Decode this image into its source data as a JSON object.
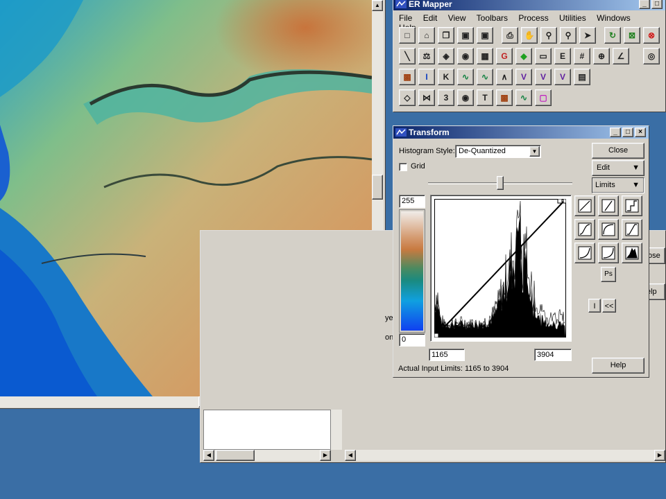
{
  "map_window": {
    "scroll_up_glyph": "▲",
    "scroll_down_glyph": "▼",
    "scroll_left_glyph": "◀",
    "scroll_right_glyph": "▶"
  },
  "er_mapper": {
    "title": "ER Mapper",
    "menus": [
      "File",
      "Edit",
      "View",
      "Toolbars",
      "Process",
      "Utilities",
      "Windows",
      "Help"
    ],
    "toolbar_rows": [
      [
        "new-icon",
        "open-icon",
        "copy-icon",
        "save-icon",
        "save-as-icon",
        "print-icon",
        "pan-hand-icon",
        "zoom-icon",
        "zoom-box-icon",
        "pointer-icon",
        "refresh-icon",
        "stop-refresh-icon",
        "close-red-icon"
      ],
      [
        "line-tool-icon",
        "balance-icon",
        "layer-icon",
        "process-icon",
        "calc-icon",
        "geo-icon",
        "layers-green-icon",
        "folder-icon",
        "formula-icon",
        "grid-icon",
        "crosshair-icon",
        "angle-icon",
        "magnifier-icon"
      ],
      [
        "image-icon",
        "info-icon",
        "filter-icon",
        "wave-icon",
        "wave2-icon",
        "chart-icon",
        "vd-icon",
        "vd2-icon",
        "vd3-icon",
        "overview-icon"
      ],
      [
        "annotation-icon",
        "mosaic-icon",
        "3d-icon",
        "traverse-icon",
        "tm-icon",
        "classify-icon",
        "wave3-icon",
        "frame-icon"
      ]
    ]
  },
  "transform": {
    "title": "Transform",
    "histogram_style_label": "Histogram Style:",
    "histogram_style_value": "De-Quantized",
    "grid_label": "Grid",
    "close_label": "Close",
    "edit_label": "Edit",
    "limits_label": "Limits",
    "output_max": "255",
    "output_min": "0",
    "input_min": "1165",
    "input_max": "3904",
    "actual_limits": "Actual Input Limits: 1165 to 3904",
    "ps_label": "Ps",
    "i_label": "I",
    "back_label": "<<",
    "help_label": "Help",
    "slider_position": 0.5,
    "transform_curves": [
      "linear-icon",
      "linear-steep-icon",
      "step-icon",
      "s-curve-icon",
      "log-curve-icon",
      "clip-linear-icon",
      "inverse-curve-icon",
      "exp-curve-icon",
      "histogram-equalize-icon"
    ]
  },
  "background_window": {
    "partial_labels": [
      "ose",
      "elp",
      "ye",
      "on"
    ]
  }
}
